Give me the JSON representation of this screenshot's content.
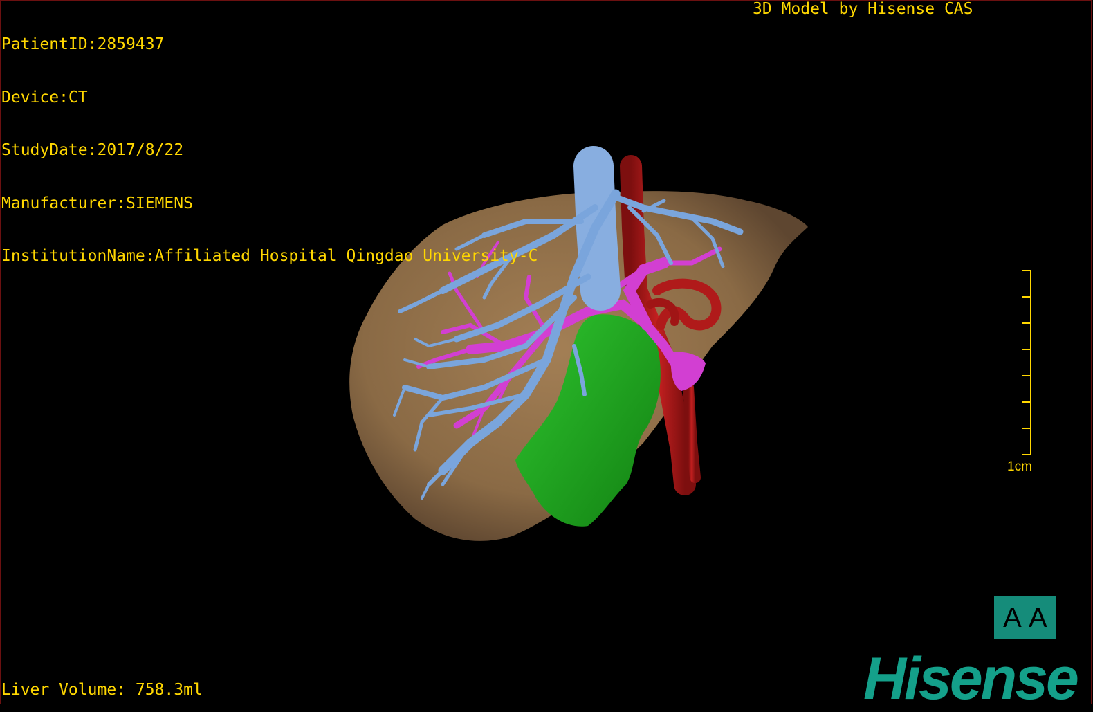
{
  "info": {
    "patient_id": "PatientID:2859437",
    "device": "Device:CT",
    "study_date": "StudyDate:2017/8/22",
    "manufacturer": "Manufacturer:SIEMENS",
    "institution": "InstitutionName:Affiliated Hospital Qingdao University-C"
  },
  "header": {
    "model_label": "3D Model by Hisense CAS"
  },
  "footer": {
    "liver_volume": "Liver Volume: 758.3ml"
  },
  "scale_bar": {
    "label": "1cm"
  },
  "orientation": {
    "left_glyph": "A",
    "right_glyph": "A"
  },
  "brand": {
    "logo_text": "Hisense"
  },
  "colors": {
    "text": "#ffd700",
    "liver": "#8a6a45",
    "hepatic_vein": "#7aa5dc",
    "portal_vein": "#d23fd2",
    "artery": "#b01a1a",
    "lesion": "#1fa31f",
    "brand": "#14a08a"
  },
  "model_structures": [
    "liver-parenchyma",
    "hepatic-veins",
    "portal-veins",
    "hepatic-artery",
    "lesion"
  ]
}
